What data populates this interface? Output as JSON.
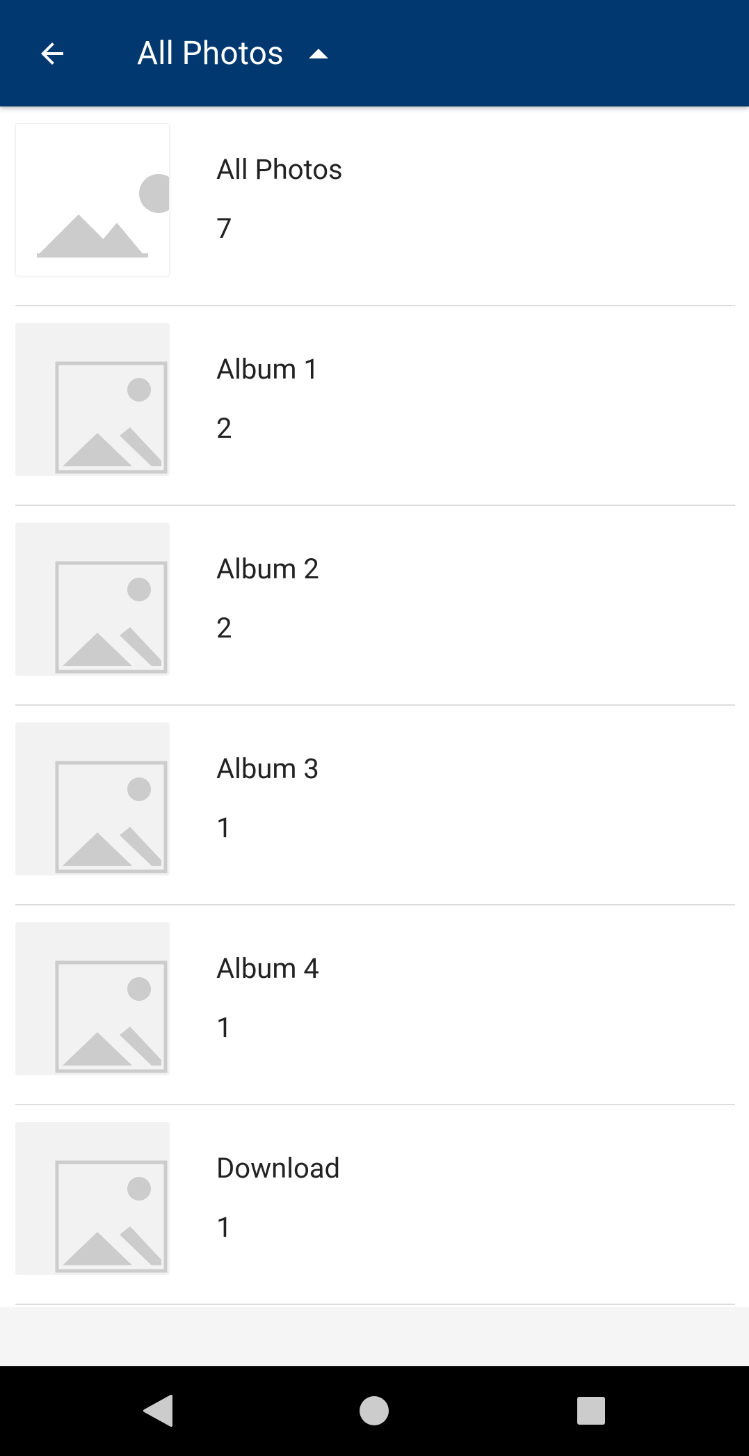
{
  "appbar": {
    "title": "All Photos",
    "background": "#01386f",
    "back_icon": "arrow-back-icon",
    "dropdown_icon": "caret-up-icon"
  },
  "albums": [
    {
      "name": "All Photos",
      "count": "7",
      "thumbnail": "image-placeholder-icon"
    },
    {
      "name": "Album 1",
      "count": "2",
      "thumbnail": "image-placeholder-icon"
    },
    {
      "name": "Album 2",
      "count": "2",
      "thumbnail": "image-placeholder-icon"
    },
    {
      "name": "Album 3",
      "count": "1",
      "thumbnail": "image-placeholder-icon"
    },
    {
      "name": "Album 4",
      "count": "1",
      "thumbnail": "image-placeholder-icon"
    },
    {
      "name": "Download",
      "count": "1",
      "thumbnail": "image-placeholder-icon"
    }
  ],
  "system_nav": {
    "back_icon": "nav-back-triangle-icon",
    "home_icon": "nav-home-circle-icon",
    "recents_icon": "nav-recents-square-icon"
  }
}
